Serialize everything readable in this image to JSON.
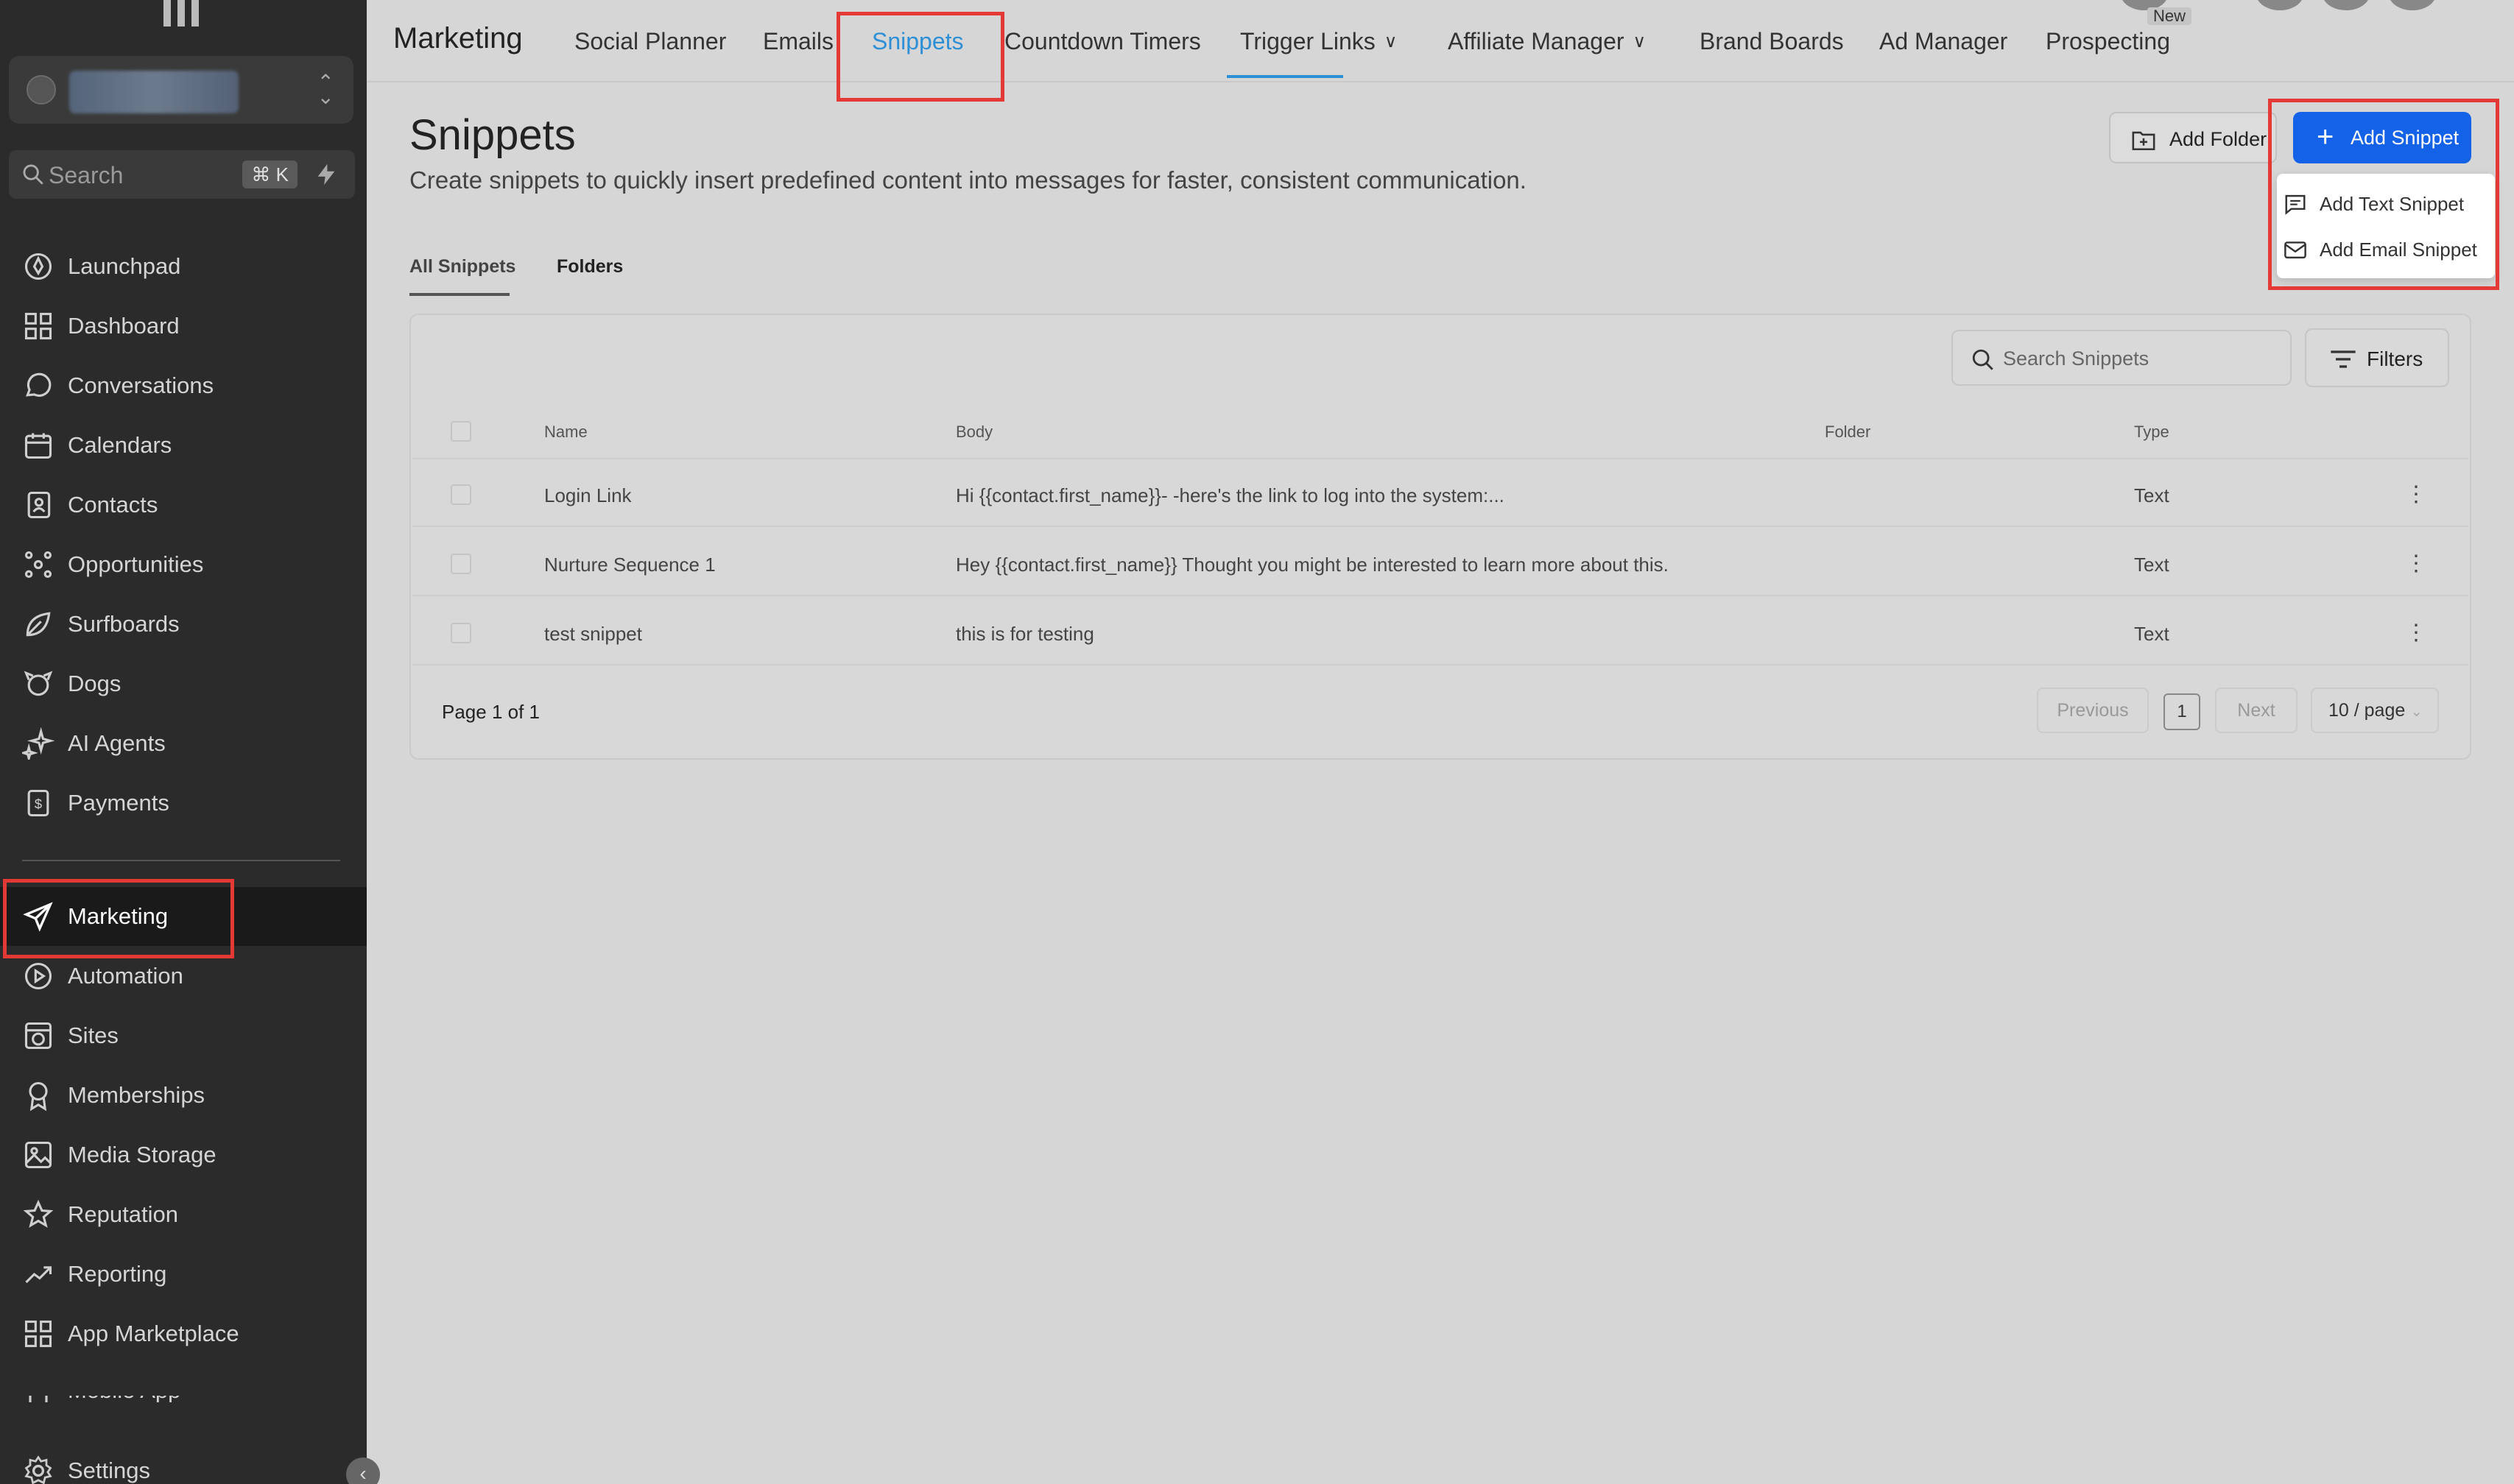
{
  "sidebar": {
    "search_placeholder": "Search",
    "search_shortcut": "⌘ K",
    "items": [
      {
        "label": "Launchpad",
        "icon": "rocket-icon"
      },
      {
        "label": "Dashboard",
        "icon": "grid-icon"
      },
      {
        "label": "Conversations",
        "icon": "chat-icon"
      },
      {
        "label": "Calendars",
        "icon": "calendar-icon"
      },
      {
        "label": "Contacts",
        "icon": "contacts-icon"
      },
      {
        "label": "Opportunities",
        "icon": "nodes-icon"
      },
      {
        "label": "Surfboards",
        "icon": "leaf-icon"
      },
      {
        "label": "Dogs",
        "icon": "dog-icon"
      },
      {
        "label": "AI Agents",
        "icon": "sparkle-icon"
      },
      {
        "label": "Payments",
        "icon": "payments-icon"
      },
      {
        "label": "Marketing",
        "icon": "send-icon",
        "active": true
      },
      {
        "label": "Automation",
        "icon": "play-circle-icon"
      },
      {
        "label": "Sites",
        "icon": "globe-window-icon"
      },
      {
        "label": "Memberships",
        "icon": "award-icon"
      },
      {
        "label": "Media Storage",
        "icon": "image-icon"
      },
      {
        "label": "Reputation",
        "icon": "star-icon"
      },
      {
        "label": "Reporting",
        "icon": "trend-icon"
      },
      {
        "label": "App Marketplace",
        "icon": "apps-icon"
      },
      {
        "label": "Mobile App",
        "icon": "phone-icon"
      }
    ],
    "settings_label": "Settings"
  },
  "topnav": {
    "brand": "Marketing",
    "tabs": [
      {
        "label": "Social Planner"
      },
      {
        "label": "Emails"
      },
      {
        "label": "Snippets",
        "active": true
      },
      {
        "label": "Countdown Timers"
      },
      {
        "label": "Trigger Links",
        "dropdown": true
      },
      {
        "label": "Affiliate Manager",
        "dropdown": true
      },
      {
        "label": "Brand Boards"
      },
      {
        "label": "Ad Manager"
      },
      {
        "label": "Prospecting"
      }
    ],
    "new_badge": "New"
  },
  "header": {
    "title": "Snippets",
    "subtitle": "Create snippets to quickly insert predefined content into messages for faster, consistent communication.",
    "add_folder_label": "Add Folder",
    "add_snippet_label": "Add Snippet",
    "dropdown": [
      {
        "label": "Add Text Snippet",
        "icon": "message-square-icon"
      },
      {
        "label": "Add Email Snippet",
        "icon": "mail-icon"
      }
    ]
  },
  "tabs": {
    "all": "All Snippets",
    "folders": "Folders"
  },
  "table": {
    "search_placeholder": "Search Snippets",
    "filters_label": "Filters",
    "columns": [
      "Name",
      "Body",
      "Folder",
      "Type"
    ],
    "rows": [
      {
        "name": "Login Link",
        "body": "Hi {{contact.first_name}}- -here's the link to log into the system:...",
        "folder": "",
        "type": "Text"
      },
      {
        "name": "Nurture Sequence 1",
        "body": "Hey {{contact.first_name}} Thought you might be interested to learn more about this.",
        "folder": "",
        "type": "Text"
      },
      {
        "name": "test snippet",
        "body": "this is for testing",
        "folder": "",
        "type": "Text"
      }
    ],
    "pagination": {
      "label": "Page 1 of 1",
      "previous": "Previous",
      "page": "1",
      "next": "Next",
      "per_page": "10 / page"
    }
  },
  "colors": {
    "accent_blue": "#1462e8",
    "active_tab": "#2d8fd6",
    "highlight_red": "#e53935",
    "sidebar_bg": "#2b2b2b"
  }
}
